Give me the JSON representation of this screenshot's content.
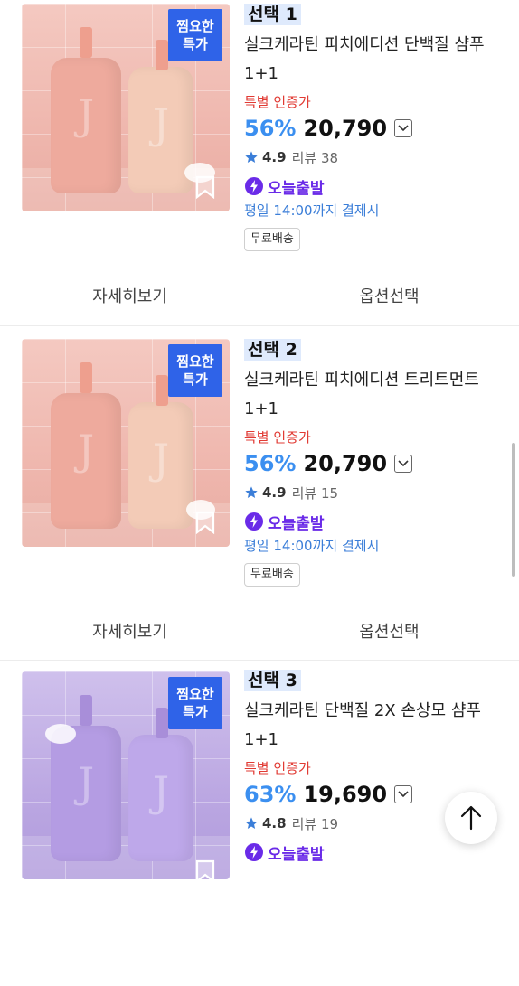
{
  "products": [
    {
      "option_label": "선택 1",
      "name": "실크케라틴 피치에디션 단백질 샴푸",
      "name_line2": "1+1",
      "badge_line1": "찜요한",
      "badge_line2": "특가",
      "special_label": "특별 인증가",
      "discount": "56%",
      "price": "20,790",
      "rating": "4.9",
      "reviews": "리뷰 38",
      "today_label": "오늘출발",
      "cutoff": "평일 14:00까지 결제시",
      "shipping": "무료배송",
      "image_theme": "pink"
    },
    {
      "option_label": "선택 2",
      "name": "실크케라틴 피치에디션 트리트먼트",
      "name_line2": "1+1",
      "badge_line1": "찜요한",
      "badge_line2": "특가",
      "special_label": "특별 인증가",
      "discount": "56%",
      "price": "20,790",
      "rating": "4.9",
      "reviews": "리뷰 15",
      "today_label": "오늘출발",
      "cutoff": "평일 14:00까지 결제시",
      "shipping": "무료배송",
      "image_theme": "pink"
    },
    {
      "option_label": "선택 3",
      "name": "실크케라틴 단백질 2X 손상모 샴푸",
      "name_line2": "1+1",
      "badge_line1": "찜요한",
      "badge_line2": "특가",
      "special_label": "특별 인증가",
      "discount": "63%",
      "price": "19,690",
      "rating": "4.8",
      "reviews": "리뷰 19",
      "today_label": "오늘출발",
      "image_theme": "purple"
    }
  ],
  "actions": {
    "detail_label": "자세히보기",
    "option_label": "옵션선택"
  },
  "icons": {
    "star": "star-icon",
    "lightning": "lightning-icon",
    "bookmark": "bookmark-icon",
    "chevron": "chevron-down-icon",
    "scroll_top": "arrow-up-icon"
  },
  "colors": {
    "discount": "#3b8ff0",
    "special": "#e13b34",
    "badge": "#2f63e8",
    "today": "#6a2be8",
    "cutoff": "#3b7ed8"
  }
}
